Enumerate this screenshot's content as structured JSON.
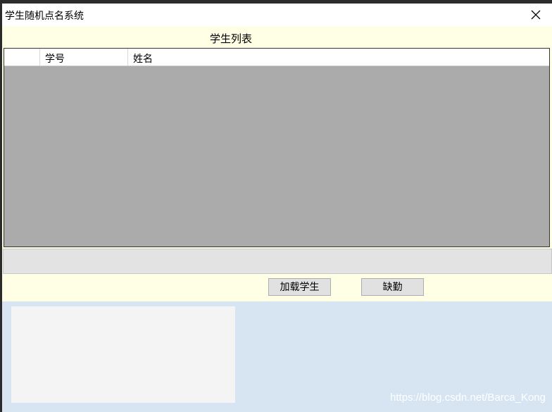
{
  "window": {
    "title": "学生随机点名系统"
  },
  "list": {
    "title": "学生列表",
    "columns": [
      "",
      "学号",
      "姓名"
    ]
  },
  "buttons": {
    "load_students": "加载学生",
    "absent": "缺勤"
  },
  "watermark": "https://blog.csdn.net/Barca_Kong",
  "icons": {
    "close": "close-icon"
  }
}
